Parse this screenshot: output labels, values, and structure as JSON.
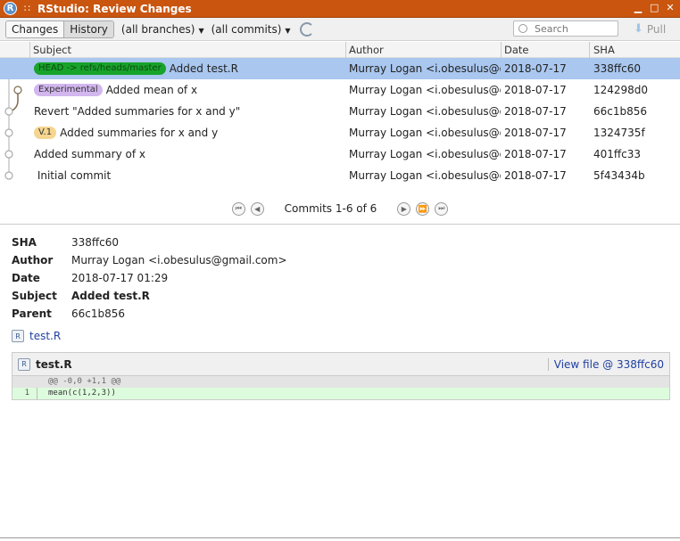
{
  "window": {
    "title": "RStudio: Review Changes",
    "app_icon_letter": "R"
  },
  "toolbar": {
    "changes_label": "Changes",
    "history_label": "History",
    "branches_label": "(all branches)",
    "commits_label": "(all commits)",
    "search_placeholder": "Search",
    "pull_label": "Pull"
  },
  "columns": {
    "subject": "Subject",
    "author": "Author",
    "date": "Date",
    "sha": "SHA"
  },
  "commits": [
    {
      "tag": "HEAD -> refs/heads/master",
      "subject": "Added test.R",
      "author": "Murray Logan <i.obesulus@gmail.com>",
      "date": "2018-07-17",
      "sha": "338ffc60"
    },
    {
      "tag": "Experimental",
      "subject": "Added mean of x",
      "author": "Murray Logan <i.obesulus@gmail.com>",
      "date": "2018-07-17",
      "sha": "124298d0"
    },
    {
      "subject": "Revert \"Added summaries for x and y\"",
      "author": "Murray Logan <i.obesulus@gmail.com>",
      "date": "2018-07-17",
      "sha": "66c1b856"
    },
    {
      "tag": "V.1",
      "subject": "Added summaries for x and y",
      "author": "Murray Logan <i.obesulus@gmail.com>",
      "date": "2018-07-17",
      "sha": "1324735f"
    },
    {
      "subject": "Added summary of x",
      "author": "Murray Logan <i.obesulus@gmail.com>",
      "date": "2018-07-17",
      "sha": "401ffc33"
    },
    {
      "subject": " Initial commit",
      "author": "Murray Logan <i.obesulus@gmail.com>",
      "date": "2018-07-17",
      "sha": "5f43434b"
    }
  ],
  "pager": {
    "label": "Commits 1-6 of 6"
  },
  "details": {
    "sha_label": "SHA",
    "sha": "338ffc60",
    "author_label": "Author",
    "author": "Murray Logan <i.obesulus@gmail.com>",
    "date_label": "Date",
    "date": "2018-07-17 01:29",
    "subject_label": "Subject",
    "subject": "Added test.R",
    "parent_label": "Parent",
    "parent": "66c1b856",
    "file": "test.R"
  },
  "diff": {
    "file": "test.R",
    "view_file": "View file @ 338ffc60",
    "hunk": "@@ -0,0 +1,1 @@",
    "line_no": "1",
    "line_code": "mean(c(1,2,3))"
  }
}
